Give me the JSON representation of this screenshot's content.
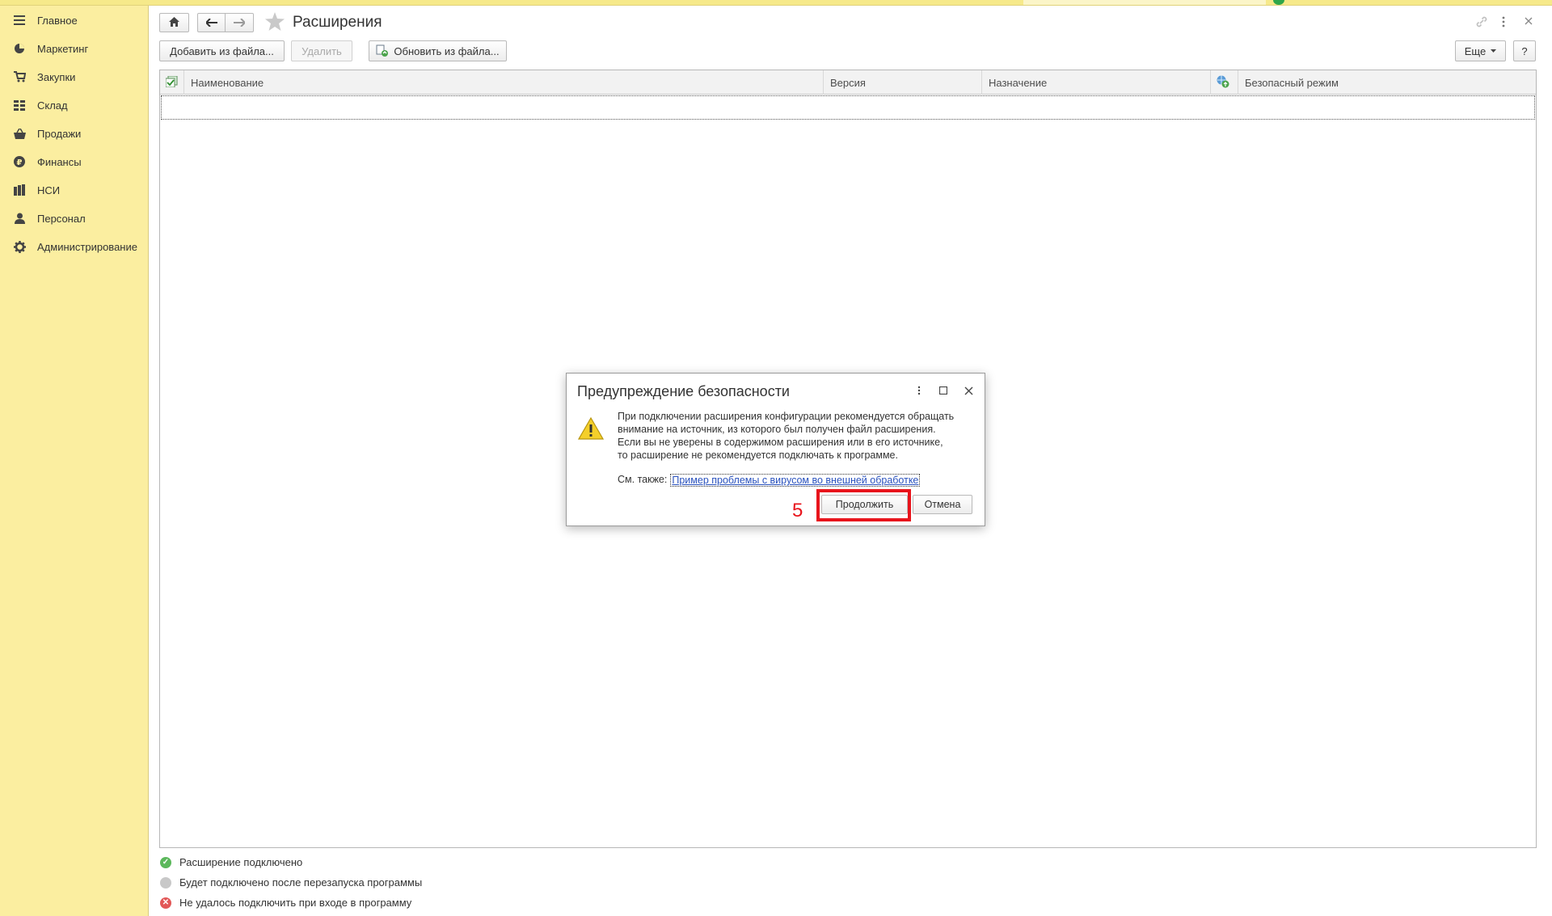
{
  "sidebar": {
    "items": [
      {
        "label": "Главное",
        "icon": "menu-icon"
      },
      {
        "label": "Маркетинг",
        "icon": "pie-chart-icon"
      },
      {
        "label": "Закупки",
        "icon": "cart-icon"
      },
      {
        "label": "Склад",
        "icon": "warehouse-grid-icon"
      },
      {
        "label": "Продажи",
        "icon": "basket-icon"
      },
      {
        "label": "Финансы",
        "icon": "ruble-icon"
      },
      {
        "label": "НСИ",
        "icon": "books-icon"
      },
      {
        "label": "Персонал",
        "icon": "person-icon"
      },
      {
        "label": "Администрирование",
        "icon": "gear-icon"
      }
    ]
  },
  "header": {
    "title": "Расширения",
    "more_label": "Еще",
    "help_label": "?"
  },
  "toolbar": {
    "add_label": "Добавить из файла...",
    "delete_label": "Удалить",
    "update_label": "Обновить из файла..."
  },
  "grid": {
    "columns": [
      "Наименование",
      "Версия",
      "Назначение",
      "Безопасный режим"
    ],
    "rows": []
  },
  "legend": [
    {
      "label": "Расширение подключено",
      "color": "#5cb85c"
    },
    {
      "label": "Будет подключено после перезапуска программы",
      "color": "#c8c8c8"
    },
    {
      "label": "Не удалось подключить при входе в программу",
      "color": "#e25858"
    }
  ],
  "dialog": {
    "title": "Предупреждение безопасности",
    "text_lines": [
      "При подключении расширения конфигурации рекомендуется обращать",
      "внимание на источник, из которого был получен файл расширения.",
      "Если вы не уверены в содержимом расширения или в его источнике,",
      "то расширение не рекомендуется подключать к программе."
    ],
    "see_also_label": "См. также:",
    "see_also_link": "Пример проблемы с вирусом во внешней обработке",
    "continue_label": "Продолжить",
    "cancel_label": "Отмена"
  },
  "annotation": {
    "step_number": "5",
    "color": "#e8141c"
  }
}
